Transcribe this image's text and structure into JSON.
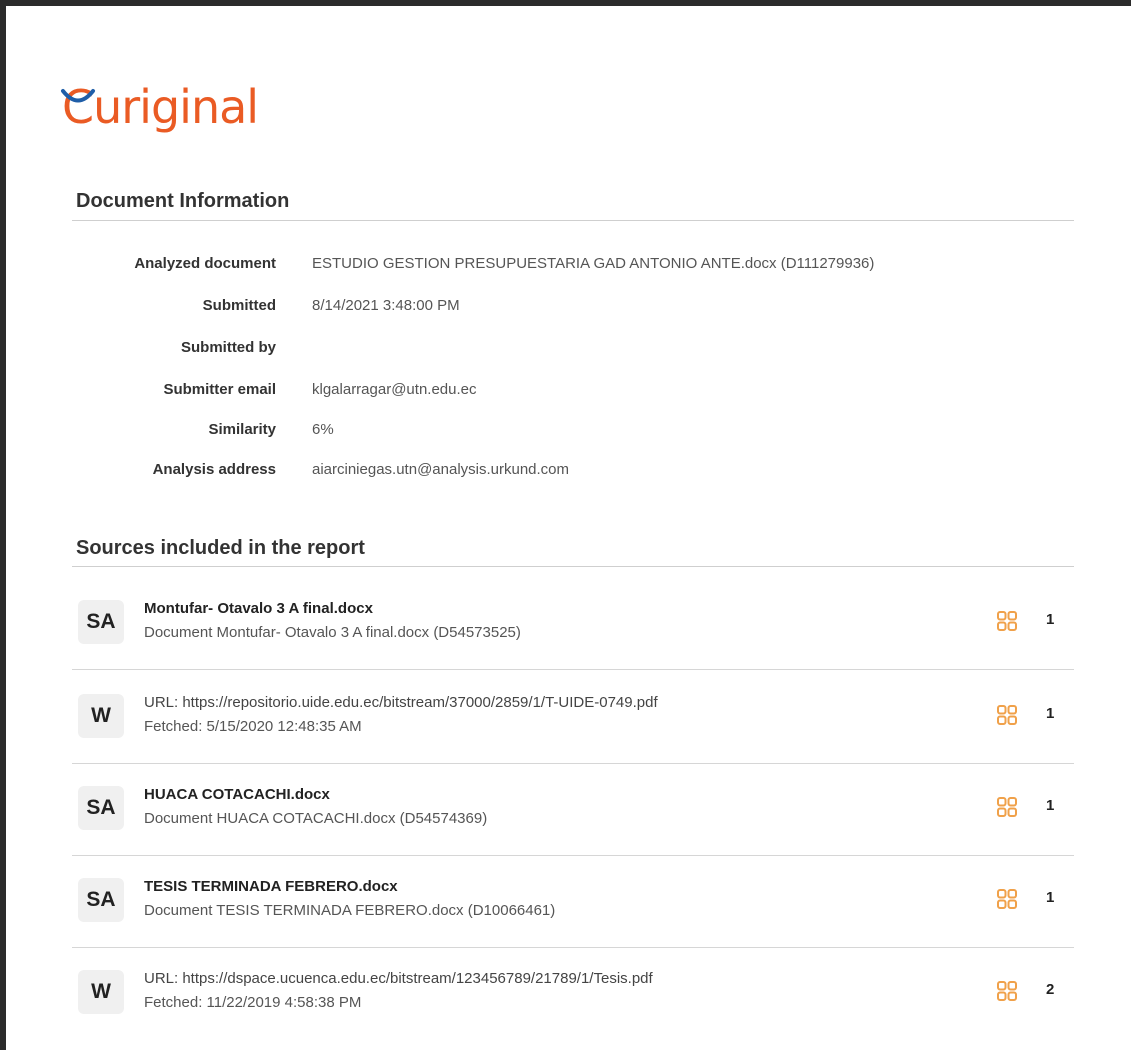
{
  "brand": {
    "logo_text": "Curiginal",
    "logo_color": "#ea5b24",
    "arc_color": "#1f5ea8"
  },
  "document_information": {
    "heading": "Document Information",
    "fields": [
      {
        "label": "Analyzed document",
        "value": "ESTUDIO GESTION PRESUPUESTARIA GAD ANTONIO ANTE.docx (D111279936)"
      },
      {
        "label": "Submitted",
        "value": "8/14/2021 3:48:00 PM"
      },
      {
        "label": "Submitted by",
        "value": ""
      },
      {
        "label": "Submitter email",
        "value": "klgalarragar@utn.edu.ec"
      },
      {
        "label": "Similarity",
        "value": "6%"
      },
      {
        "label": "Analysis address",
        "value": "aiarciniegas.utn@analysis.urkund.com"
      }
    ]
  },
  "sources": {
    "heading": "Sources included in the report",
    "icon": "grid-icon",
    "icon_color": "#f0a14a",
    "items": [
      {
        "badge": "SA",
        "title": "Montufar- Otavalo 3 A final.docx",
        "subtitle": "Document Montufar- Otavalo 3 A final.docx (D54573525)",
        "count": "1",
        "is_url": false
      },
      {
        "badge": "W",
        "title": "URL: https://repositorio.uide.edu.ec/bitstream/37000/2859/1/T-UIDE-0749.pdf",
        "subtitle": "Fetched: 5/15/2020 12:48:35 AM",
        "count": "1",
        "is_url": true
      },
      {
        "badge": "SA",
        "title": "HUACA COTACACHI.docx",
        "subtitle": "Document HUACA COTACACHI.docx (D54574369)",
        "count": "1",
        "is_url": false
      },
      {
        "badge": "SA",
        "title": "TESIS TERMINADA FEBRERO.docx",
        "subtitle": "Document TESIS TERMINADA FEBRERO.docx (D10066461)",
        "count": "1",
        "is_url": false
      },
      {
        "badge": "W",
        "title": "URL: https://dspace.ucuenca.edu.ec/bitstream/123456789/21789/1/Tesis.pdf",
        "subtitle": "Fetched: 11/22/2019 4:58:38 PM",
        "count": "2",
        "is_url": true
      }
    ]
  }
}
